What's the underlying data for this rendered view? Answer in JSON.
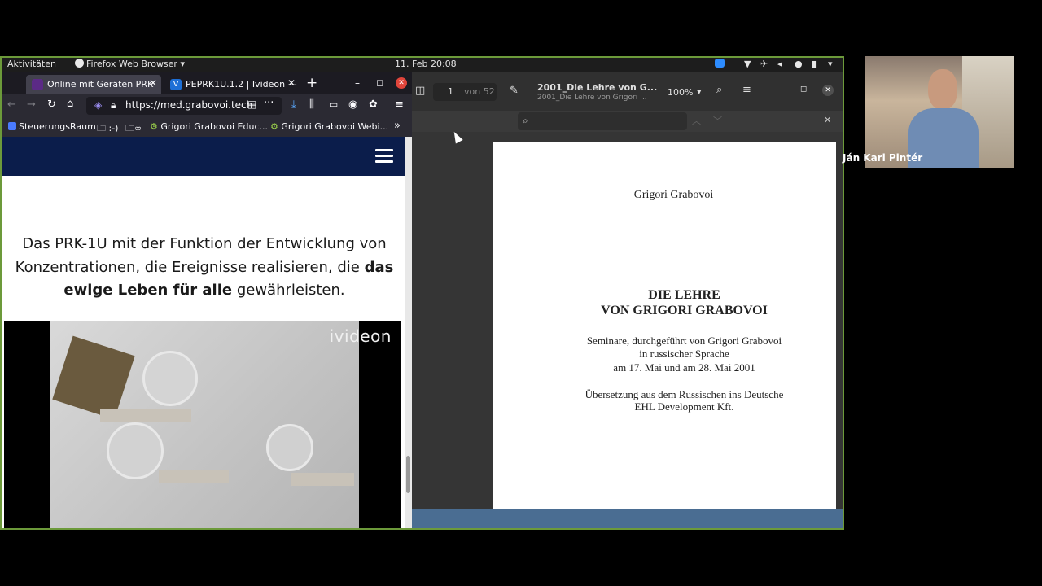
{
  "gnome": {
    "activities": "Aktivitäten",
    "app_name": "Firefox Web Browser",
    "datetime": "11. Feb  20:08"
  },
  "firefox": {
    "tabs": [
      {
        "title": "Online mit Geräten PRK",
        "active": true
      },
      {
        "title": "PEPRK1U.1.2 | Ivideon —",
        "active": false
      }
    ],
    "url": "https://med.grabovoi.tech",
    "bookmarks": [
      "SteuerungsRaum",
      ":-)",
      "∞",
      "Grigori Grabovoi Educ...",
      "Grigori Grabovoi Webi..."
    ],
    "page": {
      "heading_part1": "Das PRK-1U mit der Funktion der Entwicklung von Konzentrationen, die Ereignisse realisieren, die ",
      "heading_bold": "das ewige Leben für alle",
      "heading_part2": " gewährleisten.",
      "video_brand": "ivideon"
    }
  },
  "pdf_viewer": {
    "page_number": "1",
    "page_count": "von 52",
    "doc_title": "2001_Die Lehre von G...",
    "doc_subtitle": "2001_Die Lehre von Grigori ...",
    "zoom": "100%",
    "page": {
      "author": "Grigori Grabovoi",
      "title_line1": "DIE LEHRE",
      "title_line2": "VON GRIGORI GRABOVOI",
      "sub_line1": "Seminare, durchgeführt von Grigori Grabovoi",
      "sub_line2": "in russischer Sprache",
      "sub_line3": "am 17. Mai und am 28. Mai 2001",
      "trans_line1": "Übersetzung aus dem Russischen ins Deutsche",
      "trans_line2": "EHL Development Kft."
    }
  },
  "webcam": {
    "name": "Ján Karl Pintér"
  },
  "colors": {
    "site_header": "#0b1d4b",
    "frame": "#6c9a3a",
    "close_button": "#e0453b"
  }
}
